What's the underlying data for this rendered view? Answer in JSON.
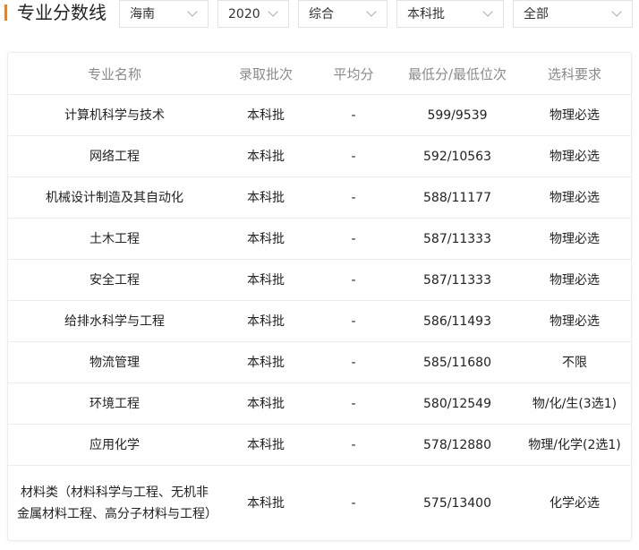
{
  "header": {
    "title": "专业分数线"
  },
  "filters": [
    {
      "name": "province-select",
      "value": "海南"
    },
    {
      "name": "year-select",
      "value": "2020"
    },
    {
      "name": "subject-type-select",
      "value": "综合"
    },
    {
      "name": "batch-select",
      "value": "本科批"
    },
    {
      "name": "category-select",
      "value": "全部"
    }
  ],
  "table": {
    "columns": [
      "专业名称",
      "录取批次",
      "平均分",
      "最低分/最低位次",
      "选科要求"
    ],
    "rows": [
      {
        "name": "计算机科学与技术",
        "batch": "本科批",
        "avg": "-",
        "min": "599/9539",
        "req": "物理必选"
      },
      {
        "name": "网络工程",
        "batch": "本科批",
        "avg": "-",
        "min": "592/10563",
        "req": "物理必选"
      },
      {
        "name": "机械设计制造及其自动化",
        "batch": "本科批",
        "avg": "-",
        "min": "588/11177",
        "req": "物理必选"
      },
      {
        "name": "土木工程",
        "batch": "本科批",
        "avg": "-",
        "min": "587/11333",
        "req": "物理必选"
      },
      {
        "name": "安全工程",
        "batch": "本科批",
        "avg": "-",
        "min": "587/11333",
        "req": "物理必选"
      },
      {
        "name": "给排水科学与工程",
        "batch": "本科批",
        "avg": "-",
        "min": "586/11493",
        "req": "物理必选"
      },
      {
        "name": "物流管理",
        "batch": "本科批",
        "avg": "-",
        "min": "585/11680",
        "req": "不限"
      },
      {
        "name": "环境工程",
        "batch": "本科批",
        "avg": "-",
        "min": "580/12549",
        "req": "物/化/生(3选1)"
      },
      {
        "name": "应用化学",
        "batch": "本科批",
        "avg": "-",
        "min": "578/12880",
        "req": "物理/化学(2选1)"
      },
      {
        "name": "材料类（材料科学与工程、无机非金属材料工程、高分子材料与工程）",
        "batch": "本科批",
        "avg": "-",
        "min": "575/13400",
        "req": "化学必选"
      }
    ]
  }
}
